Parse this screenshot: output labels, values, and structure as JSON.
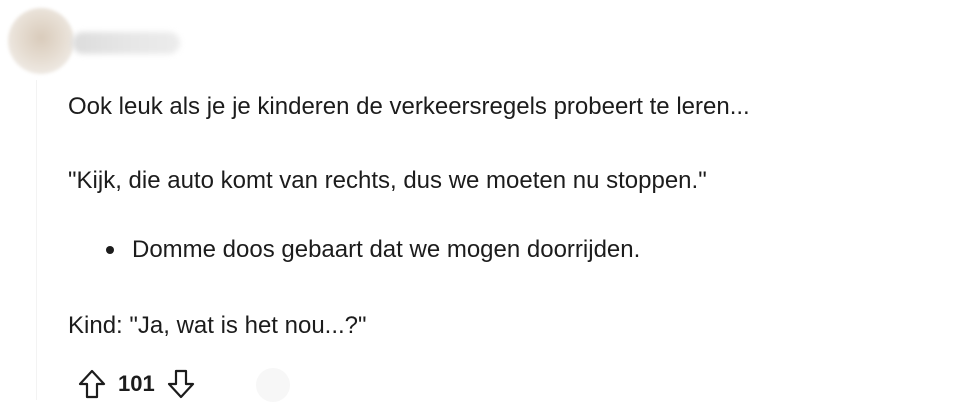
{
  "comment": {
    "author": "",
    "body": {
      "line_1": "Ook leuk als je je kinderen de verkeersregels probeert te leren...",
      "line_2": "\"Kijk, die auto komt van rechts, dus we moeten nu stoppen.\"",
      "bullets": [
        "Domme doos gebaart dat we mogen doorrijden."
      ],
      "line_4": "Kind: \"Ja, wat is het nou...?\""
    },
    "actions": {
      "score": "101",
      "upvote_icon": "upvote-arrow-icon",
      "downvote_icon": "downvote-arrow-icon"
    }
  },
  "colors": {
    "text": "#1c1c1c",
    "background": "#ffffff"
  }
}
